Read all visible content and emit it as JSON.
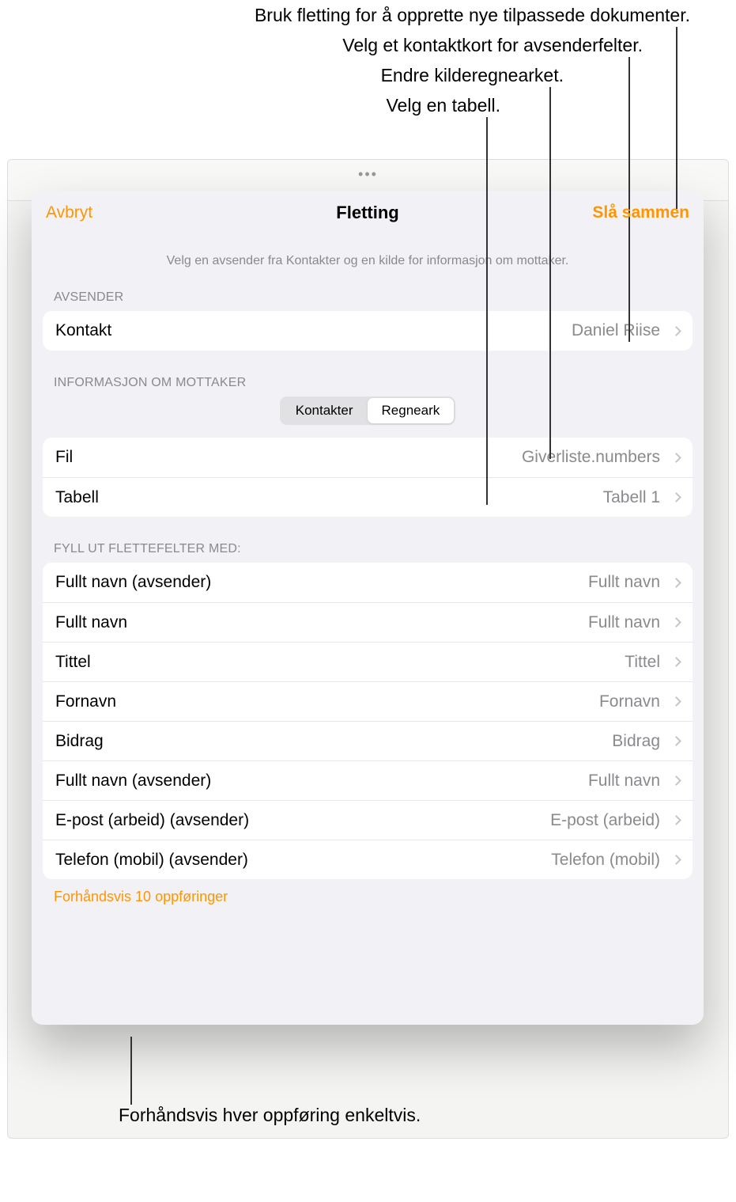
{
  "callouts": {
    "top1": "Bruk fletting for å opprette nye tilpassede dokumenter.",
    "top2": "Velg et kontaktkort for avsenderfelter.",
    "top3": "Endre kilderegnearket.",
    "top4": "Velg en tabell.",
    "bottom": "Forhåndsvis hver oppføring enkeltvis."
  },
  "panel": {
    "cancel": "Avbryt",
    "title": "Fletting",
    "merge": "Slå sammen",
    "hint": "Velg en avsender fra Kontakter og en kilde for informasjon om mottaker."
  },
  "sender": {
    "section": "AVSENDER",
    "contact_label": "Kontakt",
    "contact_value": "Daniel Riise"
  },
  "recipient": {
    "section": "INFORMASJON OM MOTTAKER",
    "seg_contacts": "Kontakter",
    "seg_spreadsheet": "Regneark",
    "file_label": "Fil",
    "file_value": "Giverliste.numbers",
    "table_label": "Tabell",
    "table_value": "Tabell 1"
  },
  "fields": {
    "section": "FYLL UT FLETTEFELTER MED:",
    "items": [
      {
        "label": "Fullt navn (avsender)",
        "value": "Fullt navn"
      },
      {
        "label": "Fullt navn",
        "value": "Fullt navn"
      },
      {
        "label": "Tittel",
        "value": "Tittel"
      },
      {
        "label": "Fornavn",
        "value": "Fornavn"
      },
      {
        "label": "Bidrag",
        "value": "Bidrag"
      },
      {
        "label": "Fullt navn (avsender)",
        "value": "Fullt navn"
      },
      {
        "label": "E-post (arbeid) (avsender)",
        "value": "E-post (arbeid)"
      },
      {
        "label": "Telefon (mobil) (avsender)",
        "value": "Telefon (mobil)"
      }
    ]
  },
  "preview_link": "Forhåndsvis 10 oppføringer",
  "colors": {
    "accent": "#ff9500",
    "bg": "#f2f2f6",
    "secondary_text": "#8a8a8e"
  }
}
